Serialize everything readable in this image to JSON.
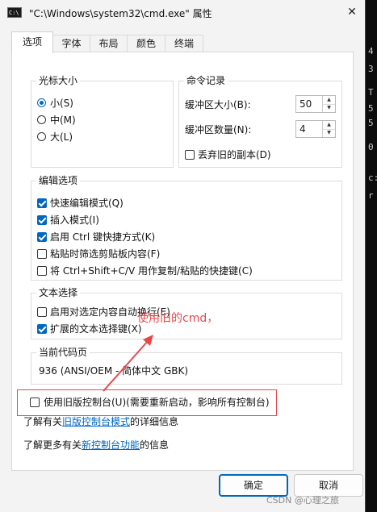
{
  "window": {
    "title": "\"C:\\Windows\\system32\\cmd.exe\" 属性",
    "icon_text": "C:\\",
    "close_glyph": "✕"
  },
  "tabs": [
    "选项",
    "字体",
    "布局",
    "颜色",
    "终端"
  ],
  "cursor_size": {
    "label": "光标大小",
    "options": [
      {
        "label": "小(S)",
        "selected": true
      },
      {
        "label": "中(M)",
        "selected": false
      },
      {
        "label": "大(L)",
        "selected": false
      }
    ]
  },
  "command_history": {
    "label": "命令记录",
    "buffer_size_label": "缓冲区大小(B):",
    "buffer_size_value": "50",
    "buffer_count_label": "缓冲区数量(N):",
    "buffer_count_value": "4",
    "discard_label": "丢弃旧的副本(D)",
    "discard_checked": false
  },
  "edit_options": {
    "label": "编辑选项",
    "items": [
      {
        "label": "快速编辑模式(Q)",
        "checked": true
      },
      {
        "label": "插入模式(I)",
        "checked": true
      },
      {
        "label": "启用 Ctrl 键快捷方式(K)",
        "checked": true
      },
      {
        "label": "粘贴时筛选剪贴板内容(F)",
        "checked": false
      },
      {
        "label": "将 Ctrl+Shift+C/V 用作复制/粘贴的快捷键(C)",
        "checked": false
      }
    ]
  },
  "text_selection": {
    "label": "文本选择",
    "items": [
      {
        "label": "启用对选定内容自动换行(E)",
        "checked": false
      },
      {
        "label": "扩展的文本选择键(X)",
        "checked": true
      }
    ]
  },
  "codepage": {
    "label": "当前代码页",
    "value": "936   (ANSI/OEM - 简体中文 GBK)"
  },
  "legacy": {
    "label": "使用旧版控制台(U)(需要重新启动，影响所有控制台)",
    "checked": false
  },
  "info1": {
    "prefix": "了解有关",
    "link": "旧版控制台模式",
    "suffix": "的详细信息"
  },
  "info2": {
    "prefix": "了解更多有关",
    "link": "新控制台功能",
    "suffix": "的信息"
  },
  "buttons": {
    "ok": "确定",
    "cancel": "取消"
  },
  "annotation": {
    "text": "使用旧的cmd，",
    "color": "#e8474a"
  },
  "watermark": "CSDN @心理之旅",
  "background_fragments": [
    ":",
    "9",
    "C",
    "d",
    "C",
    "M",
    "r",
    "0",
    "T",
    "ar",
    "K",
    "4",
    "3",
    "T",
    "5",
    "5",
    "0",
    "c:",
    "r"
  ]
}
